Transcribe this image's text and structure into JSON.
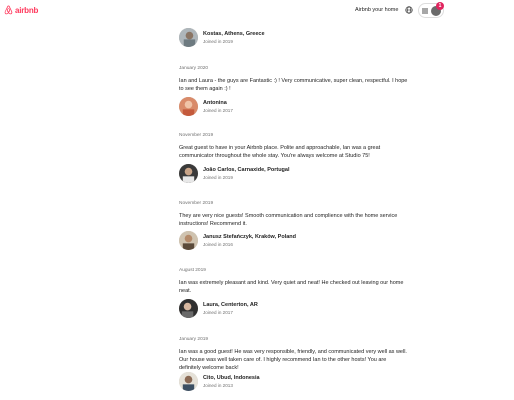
{
  "header": {
    "logo_text": "airbnb",
    "host_link": "Airbnb your home",
    "notification_count": "1",
    "brand_color": "#ff385c",
    "icons": [
      "airbnb-logo-icon",
      "globe-icon",
      "menu-icon",
      "avatar",
      "notification-badge"
    ]
  },
  "reviewers": [
    {
      "name": "Kostas, Athens, Greece",
      "joined": "Joined in 2019"
    },
    {
      "name": "Antonina",
      "joined": "Joined in 2017"
    },
    {
      "name": "João Carlos, Carnaxide, Portugal",
      "joined": "Joined in 2019"
    },
    {
      "name": "Janusz Stefańczyk, Kraków, Poland",
      "joined": "Joined in 2016"
    },
    {
      "name": "Laura, Centerton, AR",
      "joined": "Joined in 2017"
    },
    {
      "name": "Cito, Ubud, Indonesia",
      "joined": "Joined in 2013"
    }
  ],
  "reviews": [
    {
      "date": "January 2020",
      "text": "Ian and Laura - the guys are Fantastic :) ! Very communicative, super clean, respectful. I hope to see them again :) !"
    },
    {
      "date": "November 2019",
      "text": "Great guest to have in your Airbnb place. Polite and approachable, Ian was a great communicator throughout the whole stay. You're always welcome at Studio 75!"
    },
    {
      "date": "November 2019",
      "text": "They are very nice guests! Smooth communication and complience with the home service instructions! Recommend it."
    },
    {
      "date": "August 2019",
      "text": "Ian was extremely pleasant and kind. Very quiet and neat! He checked out leaving our home neat."
    },
    {
      "date": "January 2019",
      "text": "Ian was a good guest! He was very responsible, friendly, and communicated very well as well. Our house was well taken care of. I highly recommend Ian to the other hosts! You are definitely welcome back!"
    }
  ]
}
